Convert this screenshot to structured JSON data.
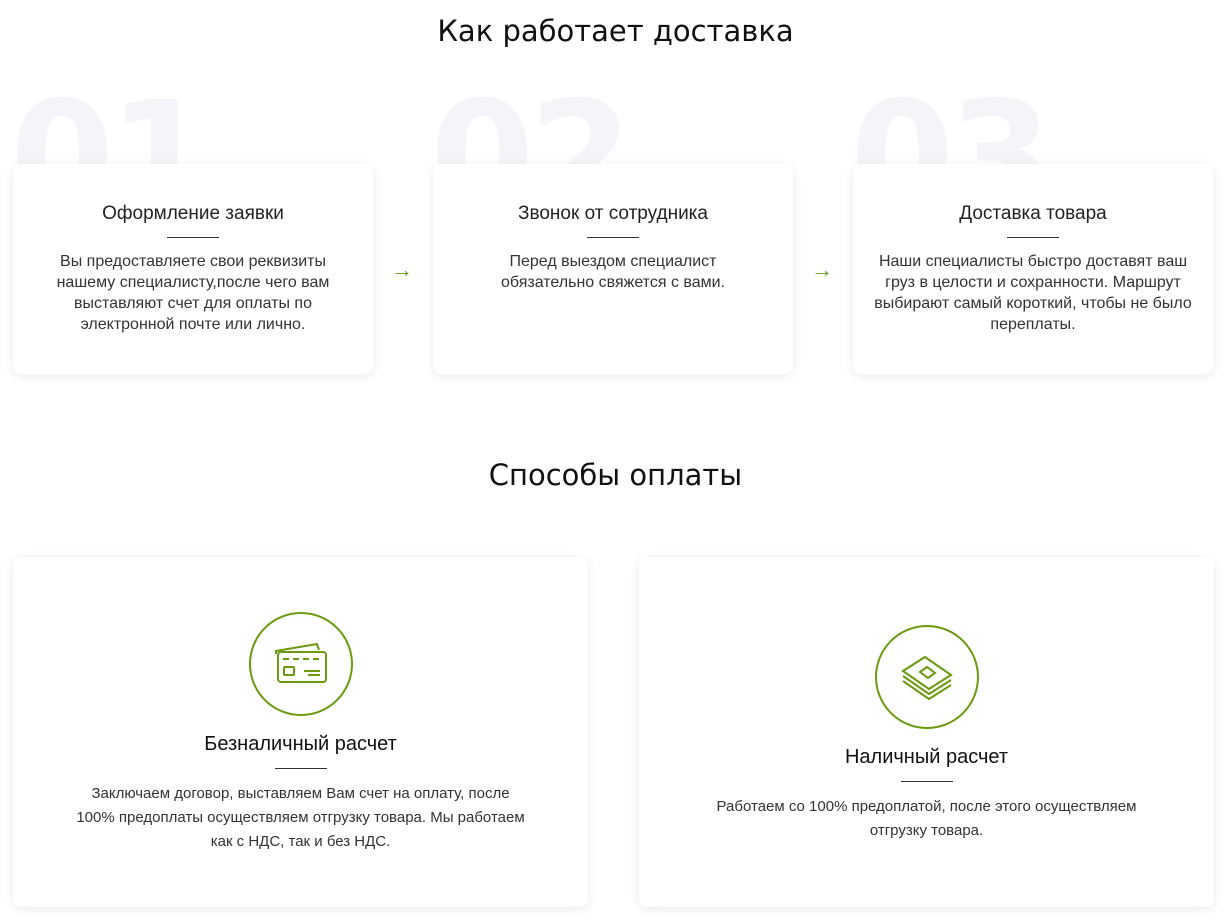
{
  "delivery": {
    "title": "Как работает доставка",
    "steps": [
      {
        "number": "01",
        "title": "Оформление заявки",
        "text": "Вы предоставляете свои реквизиты нашему специалисту,после чего вам выставляют счет для оплаты по электронной почте или лично."
      },
      {
        "number": "02",
        "title": "Звонок от сотрудника",
        "text": "Перед выездом специалист обязательно свяжется с вами."
      },
      {
        "number": "03",
        "title": "Доставка товара",
        "text": "Наши специалисты быстро доставят ваш груз в целости и сохранности. Маршрут выбирают самый короткий, чтобы не было переплаты."
      }
    ]
  },
  "payment": {
    "title": "Способы оплаты",
    "methods": [
      {
        "icon": "credit-cards-icon",
        "title": "Безналичный расчет",
        "text": "Заключаем договор, выставляем Вам счет на оплату, после 100% предоплаты осуществляем отгрузку товара. Мы работаем как с НДС, так и без НДС."
      },
      {
        "icon": "cash-stack-icon",
        "title": "Наличный расчет",
        "text": "Работаем со 100% предоплатой, после этого осуществляем отгрузку товара."
      }
    ]
  },
  "colors": {
    "accent": "#6b9a10"
  }
}
